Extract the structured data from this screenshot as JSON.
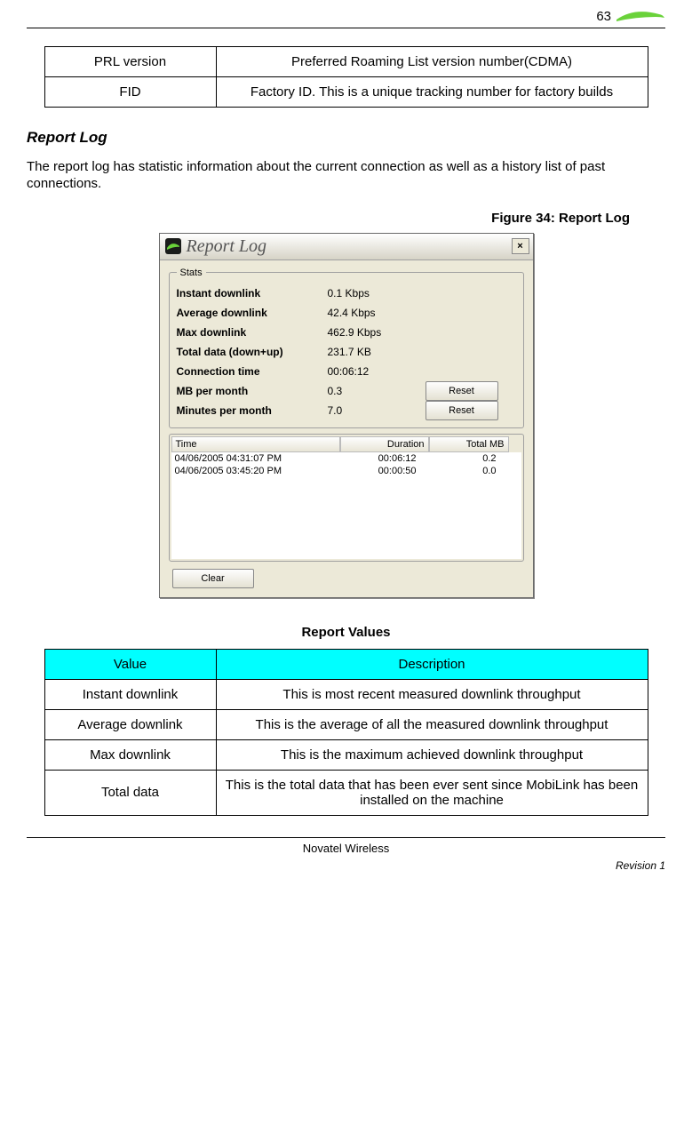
{
  "header": {
    "page_number": "63"
  },
  "table1": {
    "rows": [
      {
        "c1": "PRL version",
        "c2": "Preferred Roaming List version number(CDMA)"
      },
      {
        "c1": "FID",
        "c2": "Factory ID. This is a unique tracking number for factory builds"
      }
    ]
  },
  "section": {
    "heading": "Report Log",
    "intro": "The report log has statistic information about the current connection as well as a history list of past connections.",
    "figure_caption": "Figure 34:  Report Log"
  },
  "window": {
    "title": "Report Log",
    "close": "×",
    "stats_legend": "Stats",
    "stats": [
      {
        "label": "Instant downlink",
        "value": "0.1 Kbps",
        "button": ""
      },
      {
        "label": "Average downlink",
        "value": "42.4 Kbps",
        "button": ""
      },
      {
        "label": "Max downlink",
        "value": "462.9 Kbps",
        "button": ""
      },
      {
        "label": "Total data (down+up)",
        "value": "231.7 KB",
        "button": ""
      },
      {
        "label": "Connection time",
        "value": "00:06:12",
        "button": ""
      },
      {
        "label": "MB per month",
        "value": "0.3",
        "button": "Reset"
      },
      {
        "label": "Minutes per month",
        "value": "7.0",
        "button": "Reset"
      }
    ],
    "list_headers": {
      "time": "Time",
      "duration": "Duration",
      "total": "Total MB"
    },
    "list_rows": [
      {
        "time": "04/06/2005 04:31:07 PM",
        "duration": "00:06:12",
        "total": "0.2"
      },
      {
        "time": "04/06/2005 03:45:20 PM",
        "duration": "00:00:50",
        "total": "0.0"
      }
    ],
    "clear_label": "Clear"
  },
  "table2": {
    "title": "Report Values",
    "header": {
      "c1": "Value",
      "c2": "Description"
    },
    "rows": [
      {
        "c1": "Instant downlink",
        "c2": "This is most recent measured downlink throughput"
      },
      {
        "c1": "Average downlink",
        "c2": "This is the average of all the measured downlink throughput"
      },
      {
        "c1": "Max downlink",
        "c2": "This is the maximum achieved downlink throughput"
      },
      {
        "c1": "Total data",
        "c2": "This is the total data that has been ever sent since MobiLink has been installed on the machine"
      }
    ]
  },
  "footer": {
    "center": "Novatel Wireless",
    "right": "Revision 1"
  }
}
